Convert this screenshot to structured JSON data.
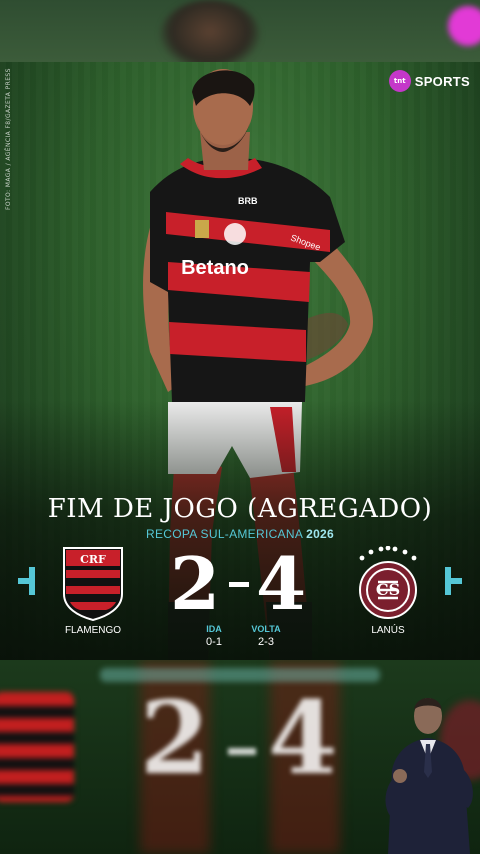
{
  "photo_credit": "FOTO: MAGA / AGÊNCIA F8/GAZETA PRESS",
  "brand": {
    "logo_text": "tnt",
    "name": "SPORTS",
    "accent": "#c437c9"
  },
  "headline": "FIM DE JOGO (AGREGADO)",
  "competition": {
    "name": "RECOPA SUL-AMERICANA",
    "year": "2026"
  },
  "match": {
    "home": {
      "name": "FLAMENGO",
      "score": "2"
    },
    "away": {
      "name": "LANÚS",
      "score": "4"
    },
    "legs": [
      {
        "label": "IDA",
        "score": "0-1"
      },
      {
        "label": "VOLTA",
        "score": "2-3"
      }
    ]
  },
  "jersey": {
    "sponsor_main": "Betano",
    "sponsor_sleeve": "Shopee",
    "sponsor_top": "BRB"
  },
  "colors": {
    "accent_cyan": "#55c7d6",
    "flamengo_red": "#c8202a",
    "lanus_maroon": "#7b1f2e"
  },
  "icons": [
    "arrow-left-icon",
    "arrow-right-icon",
    "flamengo-crest-icon",
    "lanus-crest-icon"
  ]
}
